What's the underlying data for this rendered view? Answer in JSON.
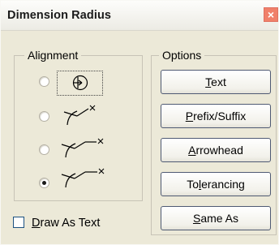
{
  "dialog": {
    "title": "Dimension Radius",
    "close_glyph": "×"
  },
  "alignment": {
    "legend": "Alignment",
    "options": [
      {
        "name": "inside-center",
        "icon": "radius-inside-icon",
        "selected": false
      },
      {
        "name": "outside-arrow-text-right",
        "icon": "radius-outside-icon",
        "selected": false
      },
      {
        "name": "outside-shoulder-text-right",
        "icon": "radius-shoulder-icon",
        "selected": false
      },
      {
        "name": "outside-long-shoulder-text-right",
        "icon": "radius-long-shoulder-icon",
        "selected": true
      }
    ]
  },
  "options": {
    "legend": "Options",
    "buttons": [
      {
        "label_pre": "",
        "mnemonic": "T",
        "label_post": "ext"
      },
      {
        "label_pre": "",
        "mnemonic": "P",
        "label_post": "refix/Suffix"
      },
      {
        "label_pre": "",
        "mnemonic": "A",
        "label_post": "rrowhead"
      },
      {
        "label_pre": "To",
        "mnemonic": "l",
        "label_post": "erancing"
      },
      {
        "label_pre": "",
        "mnemonic": "S",
        "label_post": "ame As"
      }
    ]
  },
  "draw_as_text": {
    "label_pre": "",
    "mnemonic": "D",
    "label_post": "raw As Text",
    "checked": false
  }
}
